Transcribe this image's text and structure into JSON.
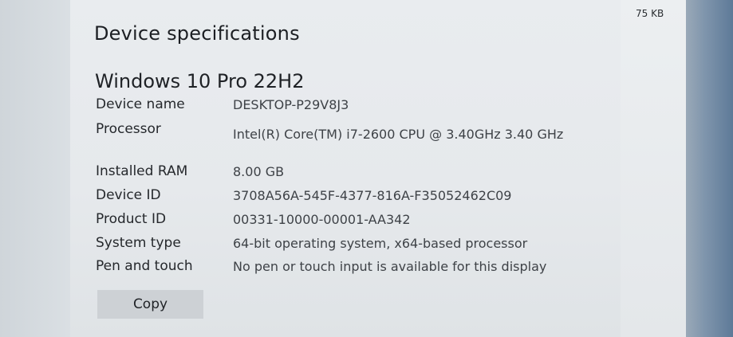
{
  "header": {
    "file_size": "75 KB",
    "section_title": "Device specifications"
  },
  "edition": "Windows 10 Pro 22H2",
  "specs": [
    {
      "label": "Device name",
      "value": "DESKTOP-P29V8J3"
    },
    {
      "label": "Processor",
      "value": "Intel(R) Core(TM) i7-2600 CPU @ 3.40GHz   3.40 GHz"
    },
    {
      "label": "Installed RAM",
      "value": "8.00 GB"
    },
    {
      "label": "Device ID",
      "value": "3708A56A-545F-4377-816A-F35052462C09"
    },
    {
      "label": "Product ID",
      "value": "00331-10000-00001-AA342"
    },
    {
      "label": "System type",
      "value": "64-bit operating system, x64-based processor"
    },
    {
      "label": "Pen and touch",
      "value": "No pen or touch input is available for this display"
    }
  ],
  "actions": {
    "copy_label": "Copy"
  }
}
